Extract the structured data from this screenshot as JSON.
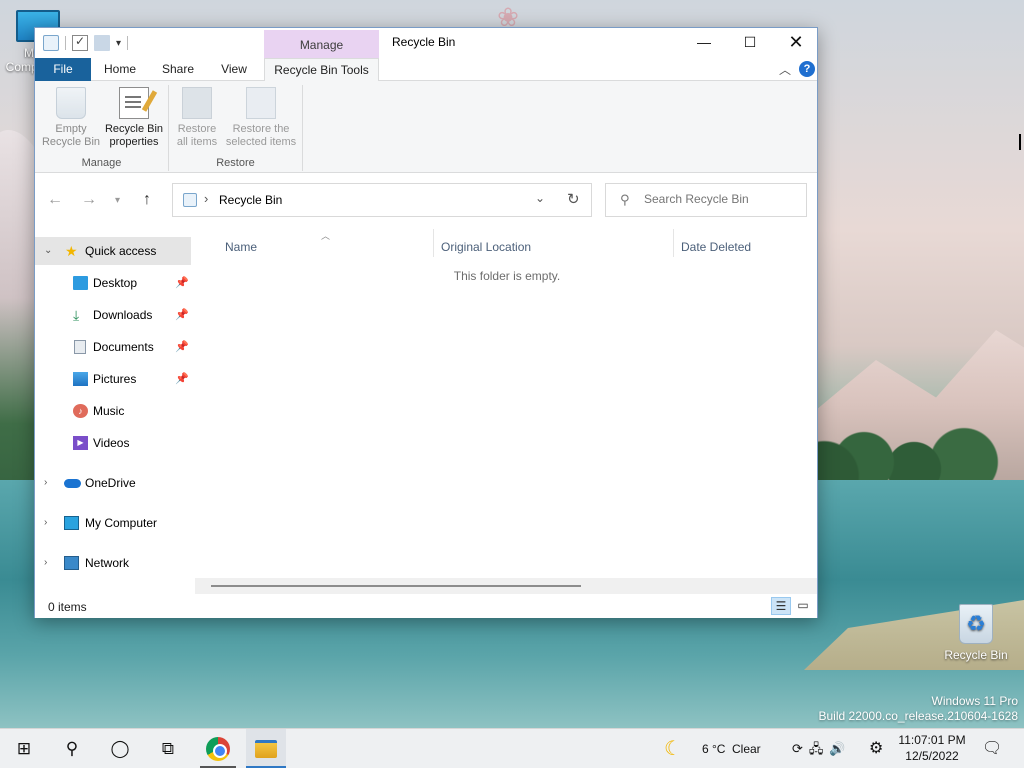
{
  "desktop": {
    "icons": [
      {
        "label": "My Computer"
      },
      {
        "label": "Recycle Bin"
      }
    ],
    "watermark": {
      "line1": "Windows 11 Pro",
      "line2": "Build 22000.co_release.210604-1628"
    }
  },
  "window": {
    "title": "Recycle Bin",
    "context_tab": "Manage",
    "controls": {
      "minimize": "—",
      "maximize": "☐",
      "close": "✕"
    }
  },
  "ribbon": {
    "tabs": [
      "File",
      "Home",
      "Share",
      "View",
      "Recycle Bin Tools"
    ],
    "help": "?",
    "groups": {
      "manage": {
        "label": "Manage",
        "buttons": [
          {
            "line1": "Empty",
            "line2": "Recycle Bin",
            "enabled": false
          },
          {
            "line1": "Recycle Bin",
            "line2": "properties",
            "enabled": true
          }
        ]
      },
      "restore": {
        "label": "Restore",
        "buttons": [
          {
            "line1": "Restore",
            "line2": "all items",
            "enabled": false
          },
          {
            "line1": "Restore the",
            "line2": "selected items",
            "enabled": false
          }
        ]
      }
    }
  },
  "navigation": {
    "address": "Recycle Bin",
    "search_placeholder": "Search Recycle Bin"
  },
  "nav_pane": {
    "quick_access": "Quick access",
    "pinned": [
      {
        "label": "Desktop",
        "pinned": true
      },
      {
        "label": "Downloads",
        "pinned": true
      },
      {
        "label": "Documents",
        "pinned": true
      },
      {
        "label": "Pictures",
        "pinned": true
      },
      {
        "label": "Music",
        "pinned": false
      },
      {
        "label": "Videos",
        "pinned": false
      }
    ],
    "roots": [
      "OneDrive",
      "My Computer",
      "Network"
    ]
  },
  "file_list": {
    "columns": [
      "Name",
      "Original Location",
      "Date Deleted"
    ],
    "empty_message": "This folder is empty."
  },
  "status": {
    "items": "0 items"
  },
  "taskbar": {
    "weather_temp": "6 °C",
    "weather_condition": "Clear",
    "time": "11:07:01 PM",
    "date": "12/5/2022"
  }
}
